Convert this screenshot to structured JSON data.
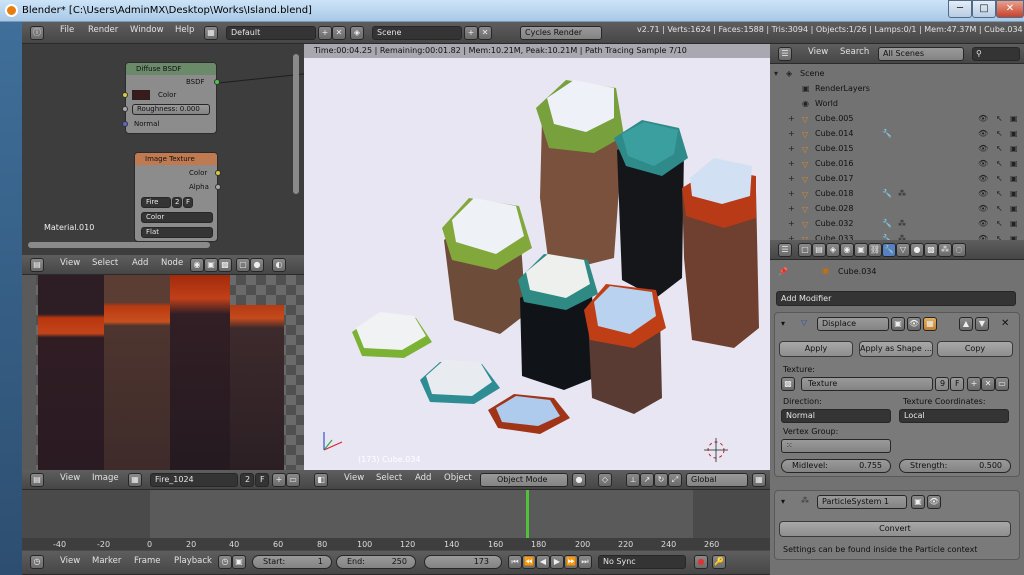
{
  "window": {
    "title": "Blender* [C:\\Users\\AdminMX\\Desktop\\Works\\Island.blend]",
    "min": "─",
    "max": "□",
    "close": "✕"
  },
  "info_header": {
    "menus": [
      "File",
      "Render",
      "Window",
      "Help"
    ],
    "layout": "Default",
    "scene": "Scene",
    "engine": "Cycles Render",
    "stats": "v2.71 | Verts:1624 | Faces:1588 | Tris:3094 | Objects:1/26 | Lamps:0/1 | Mem:47.37M | Cube.034"
  },
  "node_editor": {
    "diffuse_node": {
      "title": "Diffuse BSDF",
      "out": "BSDF",
      "color": "Color",
      "roughness": "Roughness",
      "roughness_val": "0.000",
      "normal": "Normal"
    },
    "image_node": {
      "title": "Image Texture",
      "color": "Color",
      "alpha": "Alpha",
      "image": "Fire",
      "users": "2",
      "f": "F",
      "proj": "Color",
      "interp": "Flat"
    },
    "material": "Material.010",
    "menus": [
      "View",
      "Select",
      "Add",
      "Node"
    ]
  },
  "image_editor": {
    "menus": [
      "View",
      "Image"
    ],
    "image": "Fire_1024",
    "users": "2",
    "f": "F"
  },
  "viewport": {
    "status": "Time:00:04.25 | Remaining:00:01.82 | Mem:10.21M, Peak:10.21M | Path Tracing Sample 7/10",
    "object_label": "(173) Cube.034",
    "menus": [
      "View",
      "Select",
      "Add",
      "Object"
    ],
    "mode": "Object Mode",
    "orientation": "Global"
  },
  "outliner": {
    "menus": [
      "View",
      "Search"
    ],
    "filter": "All Scenes",
    "items": [
      {
        "name": "Scene"
      },
      {
        "name": "RenderLayers"
      },
      {
        "name": "World"
      },
      {
        "name": "Cube.005"
      },
      {
        "name": "Cube.014"
      },
      {
        "name": "Cube.015"
      },
      {
        "name": "Cube.016"
      },
      {
        "name": "Cube.017"
      },
      {
        "name": "Cube.018"
      },
      {
        "name": "Cube.028"
      },
      {
        "name": "Cube.032"
      },
      {
        "name": "Cube.033"
      }
    ]
  },
  "properties": {
    "object": "Cube.034",
    "add_modifier": "Add Modifier",
    "displace": {
      "name": "Displace",
      "apply": "Apply",
      "apply_shape": "Apply as Shape ...",
      "copy": "Copy",
      "texture_label": "Texture:",
      "texture": "Texture",
      "users": "9",
      "f": "F",
      "direction_label": "Direction:",
      "direction": "Normal",
      "coords_label": "Texture Coordinates:",
      "coords": "Local",
      "vgroup_label": "Vertex Group:",
      "midlevel_label": "Midlevel:",
      "midlevel": "0.755",
      "strength_label": "Strength:",
      "strength": "0.500"
    },
    "particle": {
      "name": "ParticleSystem 1",
      "convert": "Convert",
      "note": "Settings can be found inside the Particle context"
    }
  },
  "timeline": {
    "ticks": [
      "-40",
      "-20",
      "0",
      "20",
      "40",
      "60",
      "80",
      "100",
      "120",
      "140",
      "160",
      "180",
      "200",
      "220",
      "240",
      "260"
    ],
    "menus": [
      "View",
      "Marker",
      "Frame",
      "Playback"
    ],
    "start_label": "Start:",
    "start": "1",
    "end_label": "End:",
    "end": "250",
    "current": "173",
    "sync": "No Sync"
  }
}
